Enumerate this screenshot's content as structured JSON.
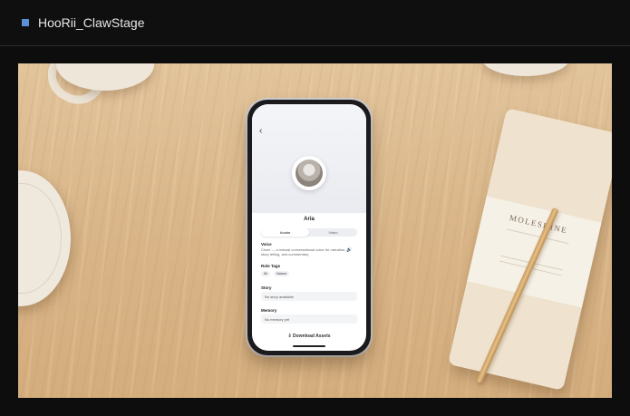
{
  "window": {
    "title": "HooRii_ClawStage",
    "accent_color": "#5b8fd6"
  },
  "scene": {
    "notebook_brand": "MOLESKINE"
  },
  "app_screen": {
    "back_icon": "chevron-left-icon",
    "character_name": "Aria",
    "tabs": [
      {
        "label": "Avatar",
        "active": true
      },
      {
        "label": "Video",
        "active": false
      }
    ],
    "voice": {
      "label": "Voice",
      "description": "Clone — a natural conversational voice for narration, story telling, and commentary.",
      "icon": "speaker-icon"
    },
    "role_tags": {
      "label": "Role Tags",
      "tags": [
        "Mi",
        "Nature"
      ]
    },
    "story": {
      "label": "Story",
      "value": "No story available"
    },
    "memory": {
      "label": "Memory",
      "value": "No memory yet"
    },
    "download_label": "Download Assets",
    "download_icon": "download-icon"
  }
}
